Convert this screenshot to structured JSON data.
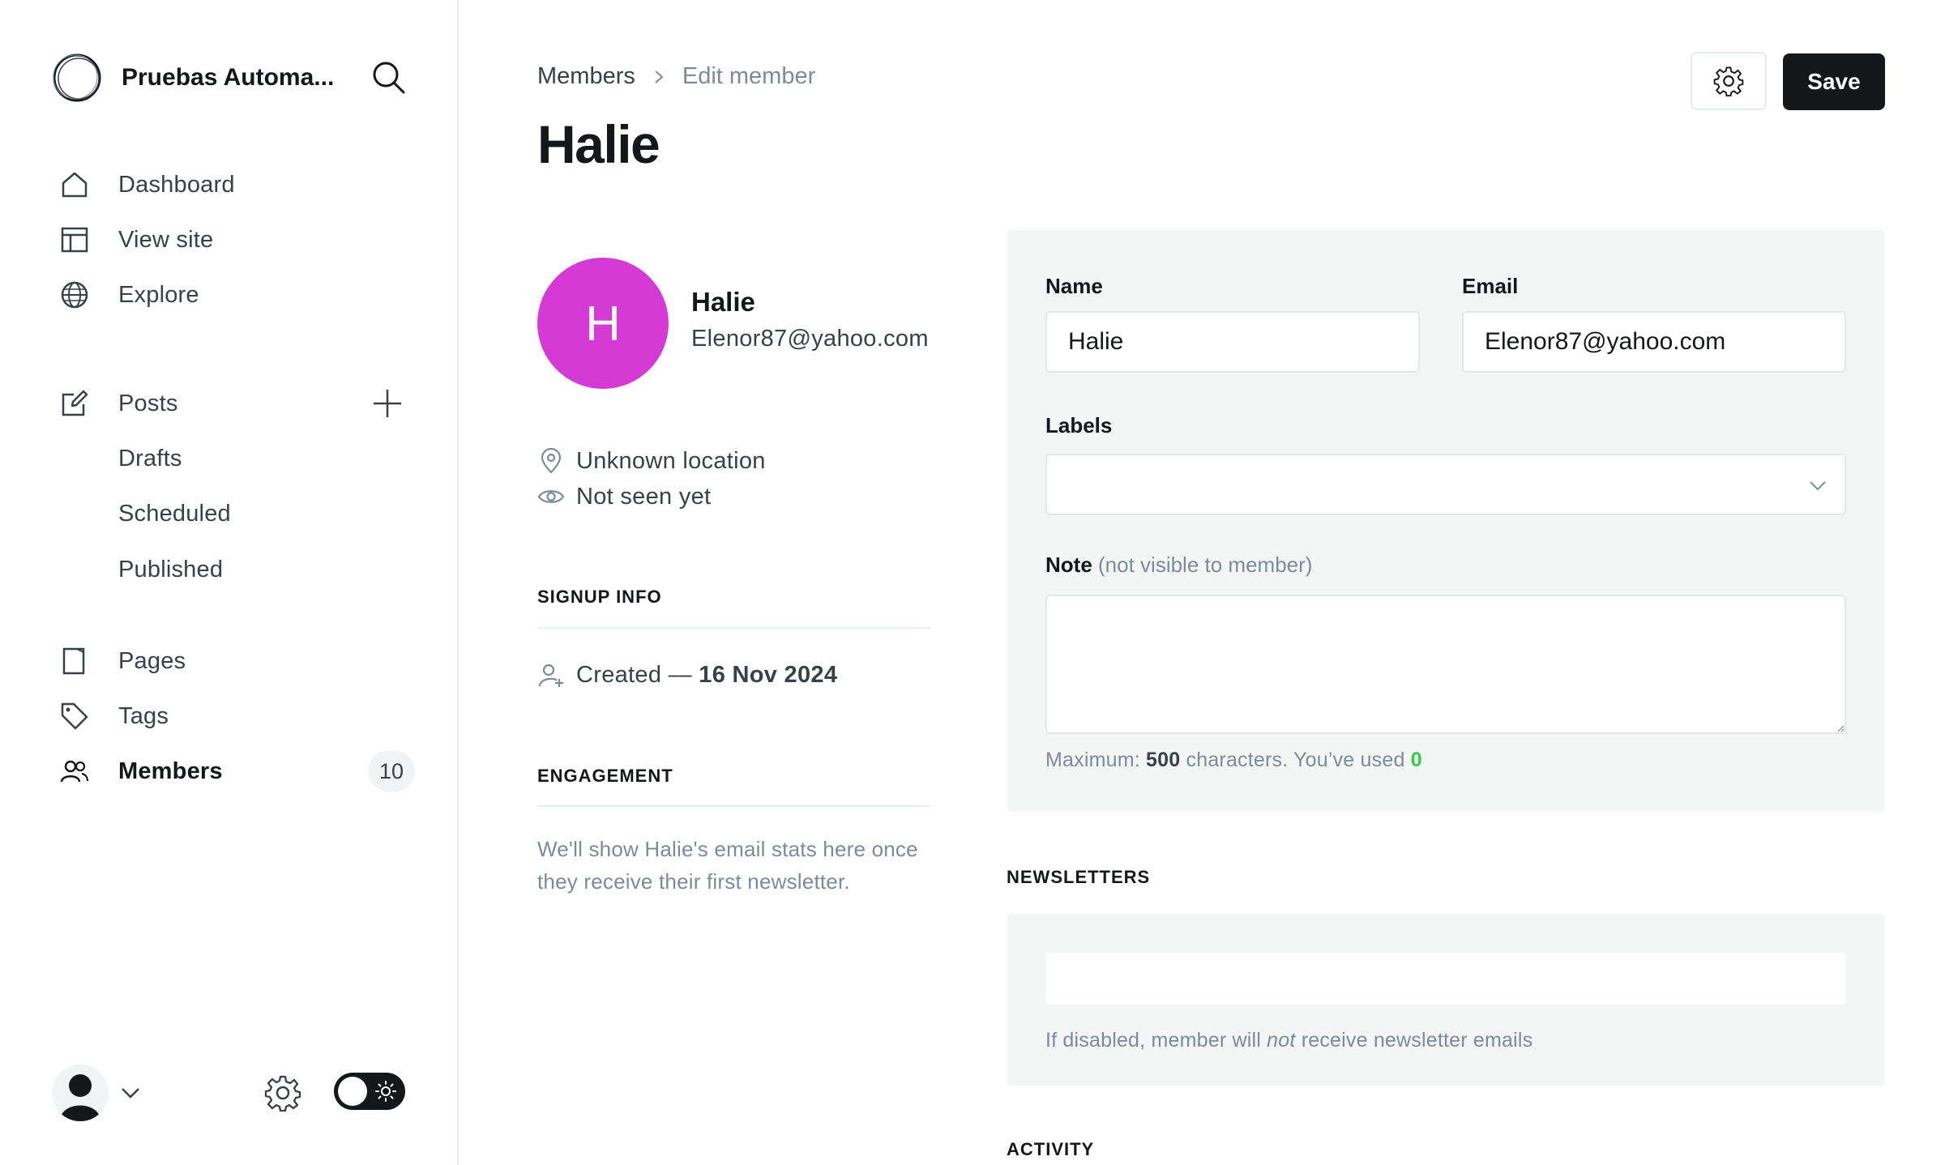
{
  "sidebar": {
    "site_name": "Pruebas Automa...",
    "nav": {
      "dashboard": "Dashboard",
      "view_site": "View site",
      "explore": "Explore",
      "posts": "Posts",
      "drafts": "Drafts",
      "scheduled": "Scheduled",
      "published": "Published",
      "pages": "Pages",
      "tags": "Tags",
      "members": "Members",
      "members_count": "10"
    }
  },
  "breadcrumb": {
    "parent": "Members",
    "current": "Edit member"
  },
  "page": {
    "title": "Halie",
    "save_label": "Save"
  },
  "member": {
    "initial": "H",
    "name": "Halie",
    "email": "Elenor87@yahoo.com",
    "location": "Unknown location",
    "last_seen": "Not seen yet",
    "avatar_color": "#d53bd4"
  },
  "signup_info": {
    "heading": "SIGNUP INFO",
    "created_prefix": "Created —",
    "created_date": "16 Nov 2024"
  },
  "engagement": {
    "heading": "ENGAGEMENT",
    "text": "We'll show Halie's email stats here once they receive their first newsletter."
  },
  "form": {
    "name_label": "Name",
    "name_value": "Halie",
    "email_label": "Email",
    "email_value": "Elenor87@yahoo.com",
    "labels_label": "Labels",
    "note_label": "Note",
    "note_hint": "(not visible to member)",
    "note_value": "",
    "max_prefix": "Maximum:",
    "max_count": "500",
    "max_middle": "characters. You’ve used",
    "used_count": "0"
  },
  "newsletters": {
    "heading": "NEWSLETTERS",
    "help_before": "If disabled, member will",
    "help_em": "not",
    "help_after": "receive newsletter emails"
  },
  "activity": {
    "heading": "ACTIVITY"
  },
  "colors": {
    "accent_green": "#30cf43",
    "primary_button": "#15171a"
  }
}
